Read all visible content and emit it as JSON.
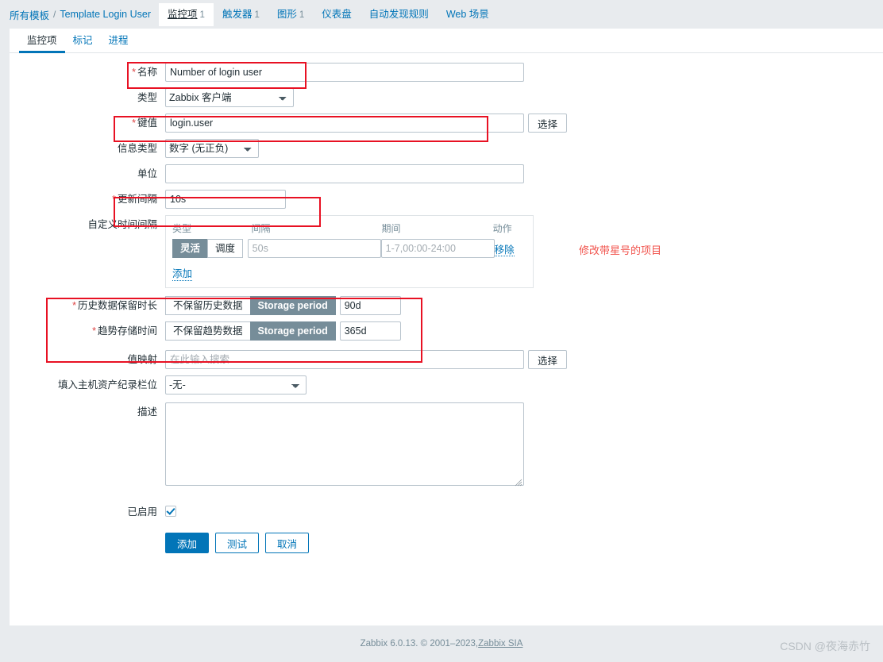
{
  "breadcrumb": {
    "all_templates": "所有模板",
    "separator": "/",
    "template_name": "Template Login User"
  },
  "top_nav": [
    {
      "label": "监控项",
      "count": "1",
      "active": true
    },
    {
      "label": "触发器",
      "count": "1",
      "active": false
    },
    {
      "label": "图形",
      "count": "1",
      "active": false
    },
    {
      "label": "仪表盘",
      "count": "",
      "active": false
    },
    {
      "label": "自动发现规则",
      "count": "",
      "active": false
    },
    {
      "label": "Web 场景",
      "count": "",
      "active": false
    }
  ],
  "sub_tabs": [
    {
      "label": "监控项",
      "active": true
    },
    {
      "label": "标记",
      "active": false
    },
    {
      "label": "进程",
      "active": false
    }
  ],
  "form": {
    "name": {
      "label": "名称",
      "required": true,
      "value": "Number of login user"
    },
    "type": {
      "label": "类型",
      "required": false,
      "value": "Zabbix 客户端"
    },
    "key": {
      "label": "键值",
      "required": true,
      "value": "login.user",
      "select_button": "选择"
    },
    "info_type": {
      "label": "信息类型",
      "required": false,
      "value": "数字 (无正负)"
    },
    "units": {
      "label": "单位",
      "required": false,
      "value": ""
    },
    "update_interval": {
      "label": "更新间隔",
      "required": true,
      "value": "10s"
    },
    "custom_intervals": {
      "label": "自定义时间间隔",
      "headers": {
        "type": "类型",
        "interval": "间隔",
        "period": "期间",
        "action": "动作"
      },
      "rows": [
        {
          "type_flexible": "灵活",
          "type_scheduling": "调度",
          "type_selected": "灵活",
          "interval_placeholder": "50s",
          "interval_value": "",
          "period_placeholder": "1-7,00:00-24:00",
          "period_value": "",
          "remove_label": "移除"
        }
      ],
      "add_label": "添加"
    },
    "history": {
      "label": "历史数据保留时长",
      "required": true,
      "option_off": "不保留历史数据",
      "option_on": "Storage period",
      "selected": "Storage period",
      "value": "90d"
    },
    "trends": {
      "label": "趋势存储时间",
      "required": true,
      "option_off": "不保留趋势数据",
      "option_on": "Storage period",
      "selected": "Storage period",
      "value": "365d"
    },
    "value_map": {
      "label": "值映射",
      "required": false,
      "value": "",
      "placeholder": "在此输入搜索",
      "select_button": "选择"
    },
    "inventory_field": {
      "label": "填入主机资产纪录栏位",
      "required": false,
      "value": "-无-"
    },
    "description": {
      "label": "描述",
      "required": false,
      "value": ""
    },
    "enabled": {
      "label": "已启用",
      "checked": true
    }
  },
  "buttons": {
    "add": "添加",
    "test": "测试",
    "cancel": "取消"
  },
  "annotation": {
    "text": "修改带星号的项目",
    "color": "#f1534c"
  },
  "footer": {
    "text": "Zabbix 6.0.13. © 2001–2023, ",
    "link": "Zabbix SIA",
    "watermark": "CSDN @夜海赤竹"
  },
  "colors": {
    "accent": "#0275b8",
    "toggle_on": "#768d99",
    "highlight_box": "#e81123",
    "page_bg": "#e8ebee"
  }
}
